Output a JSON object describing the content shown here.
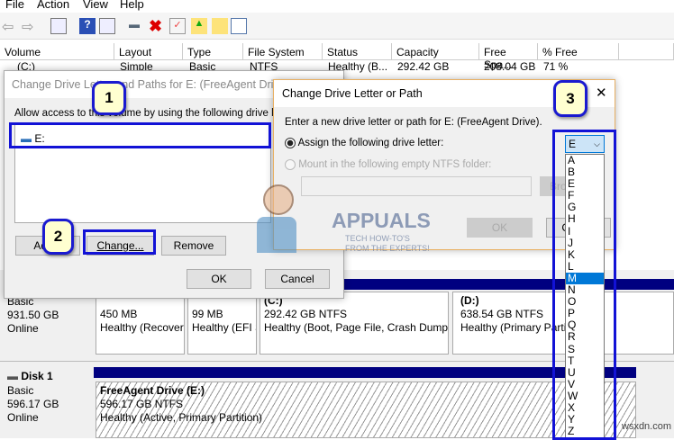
{
  "menu": [
    "File",
    "Action",
    "View",
    "Help"
  ],
  "toolbar_icons": [
    "back-icon",
    "forward-icon",
    "console-tree-icon",
    "help-icon",
    "action-pane-icon",
    "connect-drive-icon",
    "delete-icon",
    "properties-icon",
    "folder-up-icon",
    "search-folder-icon",
    "checklist-icon"
  ],
  "table": {
    "columns": [
      "Volume",
      "Layout",
      "Type",
      "File System",
      "Status",
      "Capacity",
      "Free Spa...",
      "% Free"
    ],
    "row": [
      "(C:)",
      "Simple",
      "Basic",
      "NTFS",
      "Healthy (B...",
      "292.42 GB",
      "208.04 GB",
      "71 %"
    ]
  },
  "dialog1": {
    "title": "Change Drive Letter and Paths for E: (FreeAgent Drive)",
    "label": "Allow access to this volume by using the following drive letter",
    "item": "E:",
    "add": "Add...",
    "change": "Change...",
    "remove": "Remove",
    "ok": "OK",
    "cancel": "Cancel"
  },
  "dialog2": {
    "title": "Change Drive Letter or Path",
    "close": "✕",
    "intro": "Enter a new drive letter or path for E: (FreeAgent Drive).",
    "assign": "Assign the following drive letter:",
    "mount": "Mount in the following empty NTFS folder:",
    "browse": "Browse...",
    "ok": "OK",
    "cancel": "Cancel",
    "selected_letter": "E",
    "letters": [
      "A",
      "B",
      "E",
      "F",
      "G",
      "H",
      "I",
      "J",
      "K",
      "L",
      "M",
      "N",
      "O",
      "P",
      "Q",
      "R",
      "S",
      "T",
      "U",
      "V",
      "W",
      "X",
      "Y",
      "Z"
    ],
    "highlighted": "M"
  },
  "callouts": [
    "1",
    "2",
    "3"
  ],
  "disk0": {
    "type": "Basic",
    "size": "931.50 GB",
    "status": "Online",
    "partitions": [
      {
        "name": "",
        "size": "450 MB",
        "status": "Healthy (Recovery Partition)"
      },
      {
        "name": "",
        "size": "99 MB",
        "status": "Healthy (EFI System Partition)"
      },
      {
        "name": "(C:)",
        "size": "292.42 GB NTFS",
        "status": "Healthy (Boot, Page File, Crash Dump"
      },
      {
        "name": "(D:)",
        "size": "638.54 GB NTFS",
        "status": "Healthy (Primary Partition)"
      }
    ]
  },
  "disk1": {
    "name": "Disk 1",
    "type": "Basic",
    "size": "596.17 GB",
    "status": "Online",
    "partition": {
      "name": "FreeAgent Drive  (E:)",
      "size": "596.17 GB NTFS",
      "status": "Healthy (Active, Primary Partition)"
    }
  },
  "watermark": {
    "brand": "APPUALS",
    "tagline": "TECH HOW-TO'S FROM THE EXPERTS!",
    "site": "wsxdn.com"
  }
}
